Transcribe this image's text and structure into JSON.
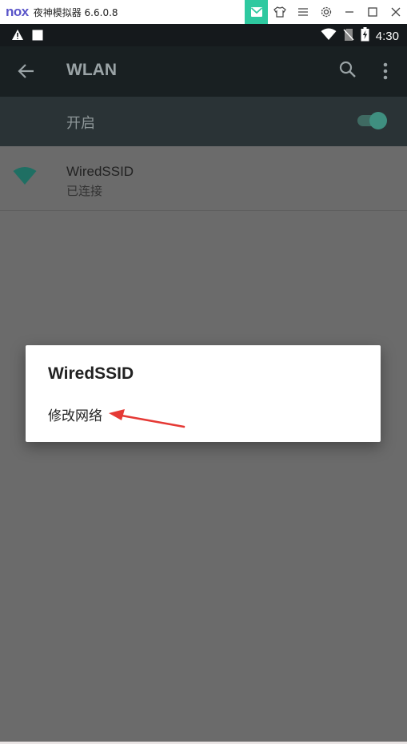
{
  "emulator": {
    "logo": "nox",
    "title": "夜神模拟器 6.6.0.8",
    "controls": [
      "mail-icon",
      "shirt-icon",
      "menu-icon",
      "gear-icon",
      "minimize-icon",
      "maximize-icon",
      "close-icon"
    ]
  },
  "status_bar": {
    "time": "4:30"
  },
  "app_bar": {
    "title": "WLAN"
  },
  "wlan_switch": {
    "label": "开启",
    "enabled": true
  },
  "networks": [
    {
      "ssid": "WiredSSID",
      "status": "已连接"
    }
  ],
  "dialog": {
    "title": "WiredSSID",
    "items": [
      {
        "label": "修改网络"
      }
    ]
  },
  "colors": {
    "accent": "#2ec9a0",
    "wifi": "#1f6f63",
    "scrim": "#6b6b6b",
    "arrow": "#e53935"
  }
}
